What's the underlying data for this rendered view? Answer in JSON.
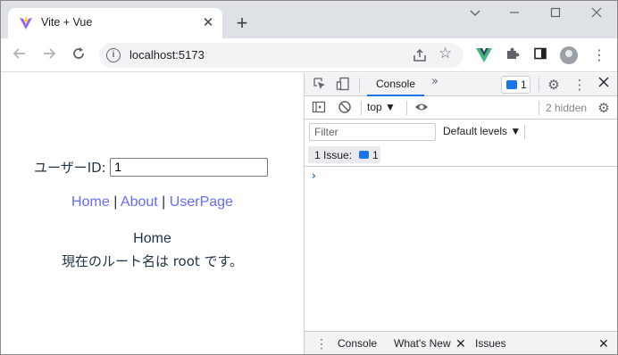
{
  "browser": {
    "tab_title": "Vite + Vue",
    "url": "localhost:5173",
    "new_tab_label": "+",
    "tab_close_label": "✕"
  },
  "page": {
    "userid_label": "ユーザーID:",
    "userid_value": "1",
    "links": [
      "Home",
      "About",
      "UserPage"
    ],
    "separator": "|",
    "view_title": "Home",
    "route_message": "現在のルート名は root です。"
  },
  "devtools": {
    "tab_console": "Console",
    "more_tabs": "»",
    "message_badge_count": "1",
    "context": "top ▼",
    "hidden": "2 hidden",
    "filter_placeholder": "Filter",
    "levels": "Default levels ▼",
    "issues_label": "1 Issue:",
    "issues_count": "1",
    "prompt": "›",
    "drawer_tabs": [
      "Console",
      "What's New",
      "Issues"
    ],
    "drawer_tab_close": "✕",
    "drawer_close": "✕"
  },
  "colors": {
    "link": "#646cff",
    "accent": "#1a73e8",
    "text": "#213547"
  }
}
